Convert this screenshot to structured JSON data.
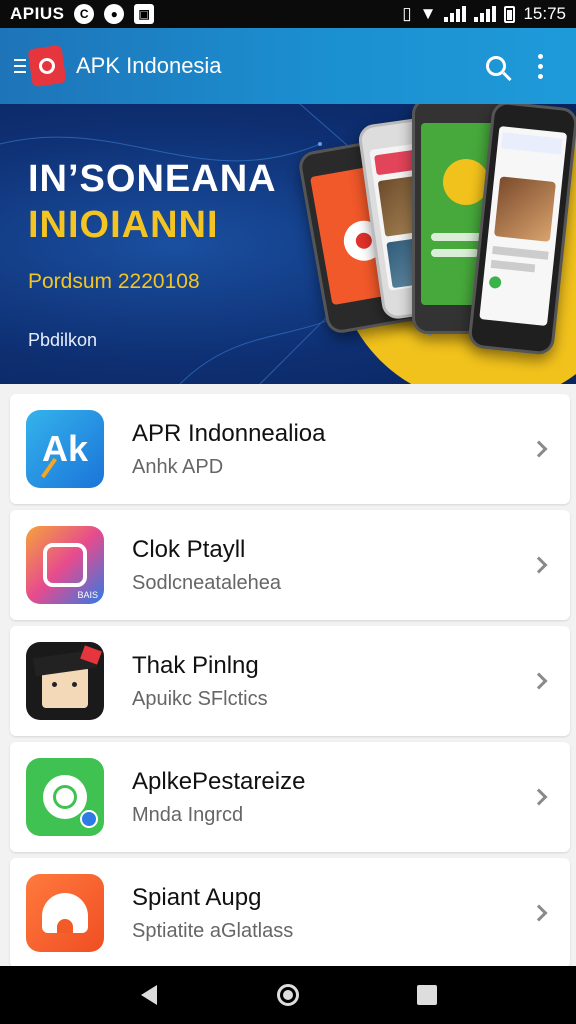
{
  "status_bar": {
    "carrier": "APIUS",
    "time": "15:75",
    "icons": [
      "circle-c-icon",
      "circle-icon",
      "square-icon",
      "vibrate-icon",
      "wifi-icon",
      "signal-icon",
      "battery-icon"
    ]
  },
  "app_bar": {
    "title": "APK Indonesia",
    "icons": [
      "menu-icon",
      "logo-icon",
      "search-icon",
      "more-vert-icon"
    ]
  },
  "banner": {
    "line1": "IN’SONEANA",
    "line2": "INIOIANNI",
    "line3": "Pordsum 2220108",
    "line4": "Pbdilkon"
  },
  "apps": [
    {
      "title": "APR Indonnealioa",
      "subtitle": "Anhk APD"
    },
    {
      "title": "Clok Ptayll",
      "subtitle": "Sodlcneatalehea"
    },
    {
      "title": "Thak Pinlng",
      "subtitle": "Apuikc SFlctics"
    },
    {
      "title": "AplkePestareize",
      "subtitle": "Mnda Ingrcd"
    },
    {
      "title": "Spiant Aupg",
      "subtitle": "Sptiatite aGlatlass"
    }
  ],
  "icon_badges": {
    "app1": "Ak",
    "app2_corner": "BAIS"
  },
  "nav_bar": {
    "icons": [
      "back-icon",
      "home-icon",
      "recents-icon"
    ]
  },
  "colors": {
    "app_bar": "#1b8fd0",
    "banner_bg": "#0e2f72",
    "banner_accent": "#f4c522",
    "logo_red": "#e5363e"
  }
}
